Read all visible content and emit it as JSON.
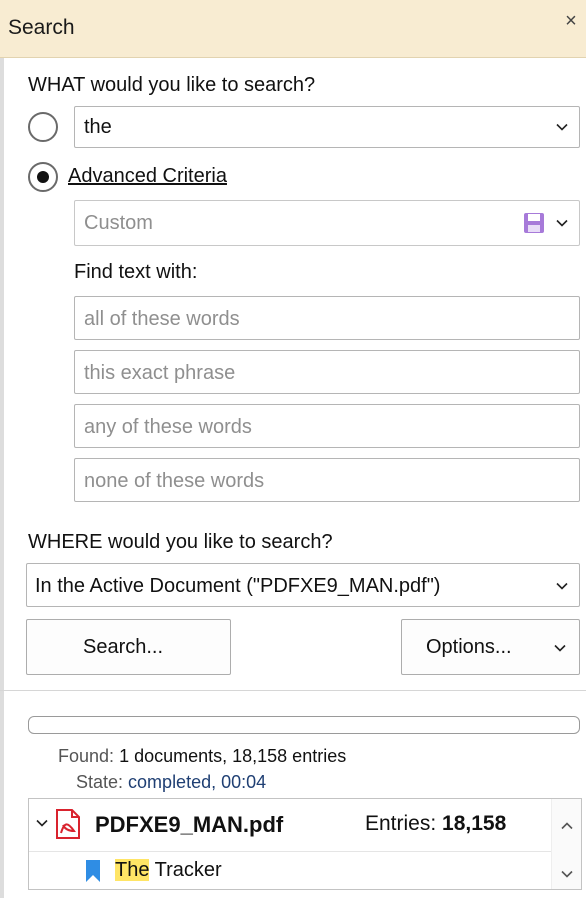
{
  "panel": {
    "title": "Search",
    "close_glyph": "×"
  },
  "what": {
    "heading": "WHAT would you like to search?",
    "simple_query": "the",
    "advanced_label": "Advanced Criteria",
    "preset_value": "Custom",
    "find_text_heading": "Find text with:",
    "fields": [
      {
        "placeholder": "all of these words"
      },
      {
        "placeholder": "this exact phrase"
      },
      {
        "placeholder": "any of these words"
      },
      {
        "placeholder": "none of these words"
      }
    ],
    "selected_mode": "advanced"
  },
  "where": {
    "heading": "WHERE would you like to search?",
    "scope_value": "In the Active Document (\"PDFXE9_MAN.pdf\")"
  },
  "buttons": {
    "search": "Search...",
    "options": "Options..."
  },
  "status": {
    "found_label": "Found:",
    "found_value": "1 documents, 18,158 entries",
    "state_label": "State:",
    "state_value": "completed, 00:04",
    "progress": 0
  },
  "results": {
    "file_name": "PDFXE9_MAN.pdf",
    "entries_label": "Entries:",
    "entries_value": "18,158",
    "first_hit_match": "The",
    "first_hit_rest": " Tracker"
  },
  "colors": {
    "title_bg": "#f8ecd2",
    "highlight": "#ffe566",
    "save_icon": "#a77ad9",
    "bookmark_icon": "#2f8de4",
    "pdf_icon": "#d9232e"
  },
  "icons": [
    "close-icon",
    "chevron-down-icon",
    "save-icon",
    "pdf-file-icon",
    "bookmark-icon",
    "collapse-arrow-icon",
    "scroll-up-icon",
    "scroll-down-icon"
  ]
}
